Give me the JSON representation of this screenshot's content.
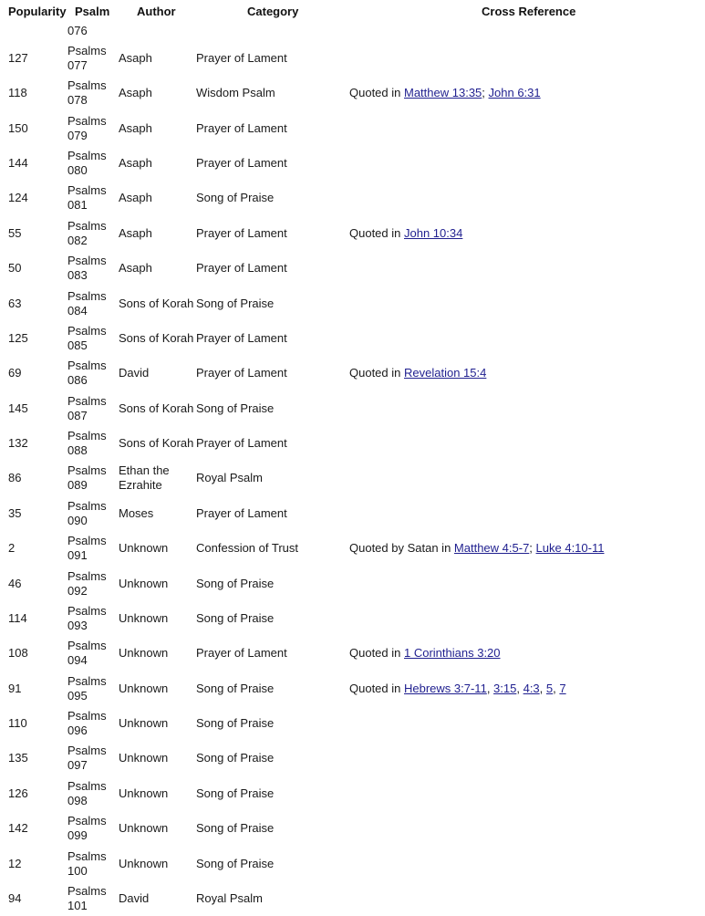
{
  "headers": {
    "popularity": "Popularity",
    "psalm": "Psalm",
    "author": "Author",
    "category": "Category",
    "cross_reference": "Cross Reference"
  },
  "link_color": "#1f1f8f",
  "partial_row": {
    "psalm_number": "076"
  },
  "rows": [
    {
      "popularity": "127",
      "psalm_prefix": "Psalms",
      "psalm_number": "077",
      "author": "Asaph",
      "category": "Prayer of Lament",
      "xref": {
        "prefix": "",
        "links": []
      }
    },
    {
      "popularity": "118",
      "psalm_prefix": "Psalms",
      "psalm_number": "078",
      "author": "Asaph",
      "category": "Wisdom Psalm",
      "xref": {
        "prefix": "Quoted in ",
        "links": [
          {
            "text": "Matthew 13:35",
            "sep": "; "
          },
          {
            "text": "John 6:31",
            "sep": ""
          }
        ]
      }
    },
    {
      "popularity": "150",
      "psalm_prefix": "Psalms",
      "psalm_number": "079",
      "author": "Asaph",
      "category": "Prayer of Lament",
      "xref": {
        "prefix": "",
        "links": []
      }
    },
    {
      "popularity": "144",
      "psalm_prefix": "Psalms",
      "psalm_number": "080",
      "author": "Asaph",
      "category": "Prayer of Lament",
      "xref": {
        "prefix": "",
        "links": []
      }
    },
    {
      "popularity": "124",
      "psalm_prefix": "Psalms",
      "psalm_number": "081",
      "author": "Asaph",
      "category": "Song of Praise",
      "xref": {
        "prefix": "",
        "links": []
      }
    },
    {
      "popularity": "55",
      "psalm_prefix": "Psalms",
      "psalm_number": "082",
      "author": "Asaph",
      "category": "Prayer of Lament",
      "xref": {
        "prefix": "Quoted in ",
        "links": [
          {
            "text": "John 10:34",
            "sep": ""
          }
        ]
      }
    },
    {
      "popularity": "50",
      "psalm_prefix": "Psalms",
      "psalm_number": "083",
      "author": "Asaph",
      "category": "Prayer of Lament",
      "xref": {
        "prefix": "",
        "links": []
      }
    },
    {
      "popularity": "63",
      "psalm_prefix": "Psalms",
      "psalm_number": "084",
      "author": "Sons of Korah",
      "category": "Song of Praise",
      "xref": {
        "prefix": "",
        "links": []
      }
    },
    {
      "popularity": "125",
      "psalm_prefix": "Psalms",
      "psalm_number": "085",
      "author": "Sons of Korah",
      "category": "Prayer of Lament",
      "xref": {
        "prefix": "",
        "links": []
      }
    },
    {
      "popularity": "69",
      "psalm_prefix": "Psalms",
      "psalm_number": "086",
      "author": "David",
      "category": "Prayer of Lament",
      "xref": {
        "prefix": "Quoted in ",
        "links": [
          {
            "text": "Revelation 15:4",
            "sep": ""
          }
        ]
      }
    },
    {
      "popularity": "145",
      "psalm_prefix": "Psalms",
      "psalm_number": "087",
      "author": "Sons of Korah",
      "category": "Song of Praise",
      "xref": {
        "prefix": "",
        "links": []
      }
    },
    {
      "popularity": "132",
      "psalm_prefix": "Psalms",
      "psalm_number": "088",
      "author": "Sons of Korah",
      "category": "Prayer of Lament",
      "xref": {
        "prefix": "",
        "links": []
      }
    },
    {
      "popularity": "86",
      "psalm_prefix": "Psalms",
      "psalm_number": "089",
      "author": "Ethan the Ezrahite",
      "category": "Royal Psalm",
      "xref": {
        "prefix": "",
        "links": []
      }
    },
    {
      "popularity": "35",
      "psalm_prefix": "Psalms",
      "psalm_number": "090",
      "author": "Moses",
      "category": "Prayer of Lament",
      "xref": {
        "prefix": "",
        "links": []
      }
    },
    {
      "popularity": "2",
      "psalm_prefix": "Psalms",
      "psalm_number": "091",
      "author": "Unknown",
      "category": "Confession of Trust",
      "xref": {
        "prefix": "Quoted by Satan in ",
        "links": [
          {
            "text": "Matthew 4:5-7",
            "sep": "; "
          },
          {
            "text": "Luke 4:10-11",
            "sep": ""
          }
        ]
      }
    },
    {
      "popularity": "46",
      "psalm_prefix": "Psalms",
      "psalm_number": "092",
      "author": "Unknown",
      "category": "Song of Praise",
      "xref": {
        "prefix": "",
        "links": []
      }
    },
    {
      "popularity": "114",
      "psalm_prefix": "Psalms",
      "psalm_number": "093",
      "author": "Unknown",
      "category": "Song of Praise",
      "xref": {
        "prefix": "",
        "links": []
      }
    },
    {
      "popularity": "108",
      "psalm_prefix": "Psalms",
      "psalm_number": "094",
      "author": "Unknown",
      "category": "Prayer of Lament",
      "xref": {
        "prefix": "Quoted in ",
        "links": [
          {
            "text": "1 Corinthians 3:20",
            "sep": ""
          }
        ]
      }
    },
    {
      "popularity": "91",
      "psalm_prefix": "Psalms",
      "psalm_number": "095",
      "author": "Unknown",
      "category": "Song of Praise",
      "xref": {
        "prefix": "Quoted in ",
        "links": [
          {
            "text": "Hebrews 3:7-11",
            "sep": ", "
          },
          {
            "text": "3:15",
            "sep": ", "
          },
          {
            "text": "4:3",
            "sep": ", "
          },
          {
            "text": "5",
            "sep": ", "
          },
          {
            "text": "7",
            "sep": ""
          }
        ]
      }
    },
    {
      "popularity": "110",
      "psalm_prefix": "Psalms",
      "psalm_number": "096",
      "author": "Unknown",
      "category": "Song of Praise",
      "xref": {
        "prefix": "",
        "links": []
      }
    },
    {
      "popularity": "135",
      "psalm_prefix": "Psalms",
      "psalm_number": "097",
      "author": "Unknown",
      "category": "Song of Praise",
      "xref": {
        "prefix": "",
        "links": []
      }
    },
    {
      "popularity": "126",
      "psalm_prefix": "Psalms",
      "psalm_number": "098",
      "author": "Unknown",
      "category": "Song of Praise",
      "xref": {
        "prefix": "",
        "links": []
      }
    },
    {
      "popularity": "142",
      "psalm_prefix": "Psalms",
      "psalm_number": "099",
      "author": "Unknown",
      "category": "Song of Praise",
      "xref": {
        "prefix": "",
        "links": []
      }
    },
    {
      "popularity": "12",
      "psalm_prefix": "Psalms",
      "psalm_number": "100",
      "author": "Unknown",
      "category": "Song of Praise",
      "xref": {
        "prefix": "",
        "links": []
      }
    },
    {
      "popularity": "94",
      "psalm_prefix": "Psalms",
      "psalm_number": "101",
      "author": "David",
      "category": "Royal Psalm",
      "xref": {
        "prefix": "",
        "links": []
      }
    }
  ]
}
